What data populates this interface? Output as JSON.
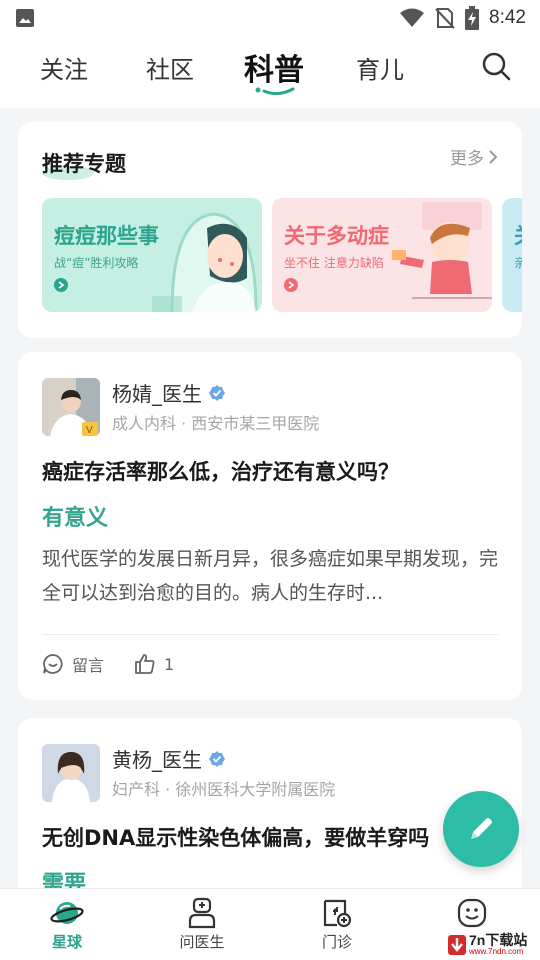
{
  "status_bar": {
    "time": "8:42"
  },
  "top_tabs": [
    {
      "label": "关注"
    },
    {
      "label": "社区"
    },
    {
      "label": "科普"
    },
    {
      "label": "育儿"
    }
  ],
  "topics": {
    "title": "推荐专题",
    "more": "更多",
    "items": [
      {
        "title": "痘痘那些事",
        "subtitle": "战“痘”胜利攻略"
      },
      {
        "title": "关于多动症",
        "subtitle": "坐不住 注意力缺陷"
      },
      {
        "title": "关",
        "subtitle": "亲"
      }
    ]
  },
  "posts": [
    {
      "author": "杨婧_医生",
      "meta": "成人内科 · 西安市某三甲医院",
      "title": "癌症存活率那么低，治疗还有意义吗？",
      "answer": "有意义",
      "excerpt": "现代医学的发展日新月异，很多癌症如果早期发现，完全可以达到治愈的目的。病人的生存时...",
      "comment_label": "留言",
      "like_count": "1"
    },
    {
      "author": "黄杨_医生",
      "meta": "妇产科 · 徐州医科大学附属医院",
      "title": "无创DNA显示性染色体偏高，要做羊穿吗",
      "answer": "需要"
    }
  ],
  "bottom_nav": [
    {
      "label": "星球"
    },
    {
      "label": "问医生"
    },
    {
      "label": "门诊"
    },
    {
      "label": ""
    }
  ],
  "watermark": {
    "text": "7n下载站",
    "url": "www.7ndn.com"
  },
  "colors": {
    "accent": "#2ba58d",
    "fab": "#2dbda6",
    "pink": "#ef6a73"
  }
}
